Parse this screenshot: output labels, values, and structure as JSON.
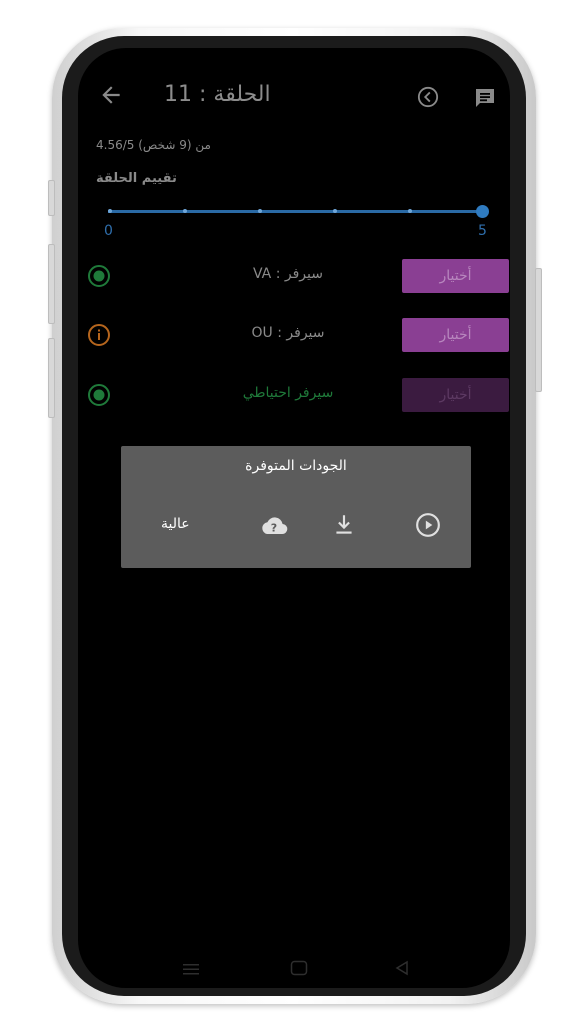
{
  "header": {
    "title": "الحلقة : 11"
  },
  "rating": {
    "summary": "4.56/5 من (9 شخص)",
    "title": "تقييم الحلقة",
    "slider_min": "0",
    "slider_max": "5",
    "slider_value": 5
  },
  "servers": [
    {
      "label": "سيرفر : VA",
      "status": "ok",
      "button": "أختيار"
    },
    {
      "label": "سيرفر : OU",
      "status": "info",
      "button": "أختيار"
    },
    {
      "label": "سيرفر احتياطي",
      "status": "ok",
      "button": "أختيار"
    }
  ],
  "dialog": {
    "title": "الجودات المتوفرة",
    "quality": "عالية",
    "icons": [
      "play-circle-icon",
      "download-icon",
      "cloud-help-icon"
    ]
  },
  "colors": {
    "accent_purple": "#8a3f93",
    "slider_blue": "#2f7bc0",
    "status_green": "#1f7a3a",
    "status_orange": "#b5651d",
    "dialog_bg": "#5c5c5c"
  }
}
